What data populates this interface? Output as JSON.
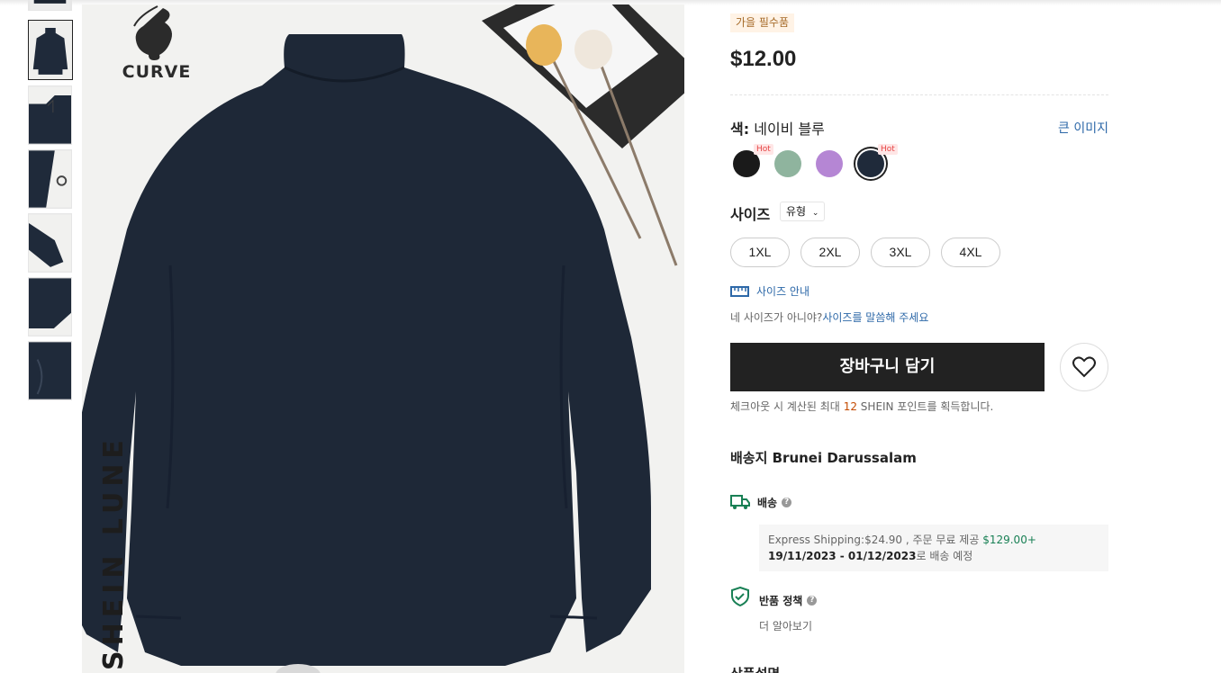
{
  "thumbnails": [
    {
      "name": "thumb-front",
      "active": true
    },
    {
      "name": "thumb-collar",
      "active": false
    },
    {
      "name": "thumb-zipper",
      "active": false
    },
    {
      "name": "thumb-cuff",
      "active": false
    },
    {
      "name": "thumb-hem",
      "active": false
    },
    {
      "name": "thumb-pocket",
      "active": false
    }
  ],
  "main_image": {
    "logo_text": "CURVE",
    "vertical_text": "SHEIN LUNE"
  },
  "product": {
    "tag": "가을 필수품",
    "price": "$12.00"
  },
  "color": {
    "label": "색:",
    "value": "네이비 블루",
    "big_image_link": "큰 이미지",
    "swatches": [
      {
        "name": "black",
        "color": "#1a1a1a",
        "hot": true,
        "selected": false
      },
      {
        "name": "sage-green",
        "color": "#8fb49e",
        "hot": false,
        "selected": false
      },
      {
        "name": "lavender",
        "color": "#b586d4",
        "hot": false,
        "selected": false
      },
      {
        "name": "navy-blue",
        "color": "#1f2a3a",
        "hot": true,
        "selected": true
      }
    ],
    "hot_label": "Hot"
  },
  "size": {
    "label": "사이즈",
    "type_label": "유형",
    "options": [
      "1XL",
      "2XL",
      "3XL",
      "4XL"
    ],
    "guide_label": "사이즈 안내",
    "hint_prefix": "네 사이즈가 아니야?",
    "hint_link": "사이즈를 말씀해 주세요"
  },
  "actions": {
    "add_to_cart": "장바구니 담기",
    "points_prefix": "체크아웃 시 계산된 최대",
    "points_value": "12",
    "points_suffix": "SHEIN 포인트를 획득합니다."
  },
  "shipping": {
    "ship_to": "배송지 Brunei Darussalam",
    "title": "배송",
    "line1_prefix": "Express Shipping:$24.90 , 주문 무료 제공",
    "line1_free": "$129.00+",
    "line2_date": "19/11/2023 - 01/12/2023",
    "line2_suffix": "로 배송 예정"
  },
  "returns": {
    "title": "반품 정책",
    "learn_more": "더 알아보기"
  },
  "description": {
    "title": "상품설명"
  },
  "colors": {
    "accent_link": "#2d68a8",
    "cart_button": "#222222",
    "ship_green": "#198055",
    "points_orange": "#c44a01"
  }
}
